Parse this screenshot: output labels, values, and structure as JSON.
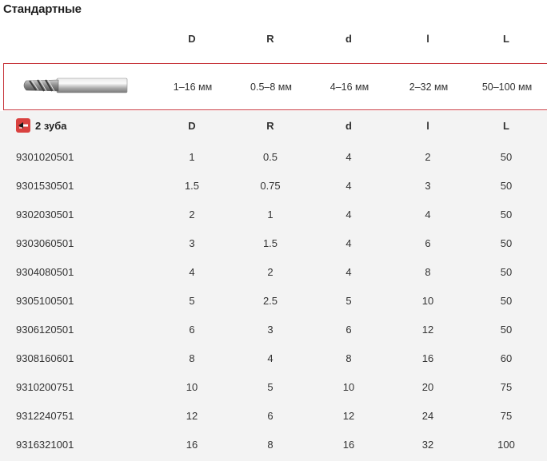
{
  "section": {
    "title": "Стандартные"
  },
  "columns": [
    "D",
    "R",
    "d",
    "l",
    "L"
  ],
  "ranges": [
    "1–16 мм",
    "0.5–8 мм",
    "4–16 мм",
    "2–32 мм",
    "50–100 мм"
  ],
  "group": {
    "label": "2 зуба",
    "icon": "two-flute-icon",
    "columns": [
      "D",
      "R",
      "d",
      "l",
      "L"
    ]
  },
  "rows": [
    {
      "code": "9301020501",
      "D": "1",
      "R": "0.5",
      "d": "4",
      "l": "2",
      "L": "50"
    },
    {
      "code": "9301530501",
      "D": "1.5",
      "R": "0.75",
      "d": "4",
      "l": "3",
      "L": "50"
    },
    {
      "code": "9302030501",
      "D": "2",
      "R": "1",
      "d": "4",
      "l": "4",
      "L": "50"
    },
    {
      "code": "9303060501",
      "D": "3",
      "R": "1.5",
      "d": "4",
      "l": "6",
      "L": "50"
    },
    {
      "code": "9304080501",
      "D": "4",
      "R": "2",
      "d": "4",
      "l": "8",
      "L": "50"
    },
    {
      "code": "9305100501",
      "D": "5",
      "R": "2.5",
      "d": "5",
      "l": "10",
      "L": "50"
    },
    {
      "code": "9306120501",
      "D": "6",
      "R": "3",
      "d": "6",
      "l": "12",
      "L": "50"
    },
    {
      "code": "9308160601",
      "D": "8",
      "R": "4",
      "d": "8",
      "l": "16",
      "L": "60"
    },
    {
      "code": "9310200751",
      "D": "10",
      "R": "5",
      "d": "10",
      "l": "20",
      "L": "75"
    },
    {
      "code": "9312240751",
      "D": "12",
      "R": "6",
      "d": "12",
      "l": "24",
      "L": "75"
    },
    {
      "code": "9316321001",
      "D": "16",
      "R": "8",
      "d": "16",
      "l": "32",
      "L": "100"
    }
  ],
  "colors": {
    "accent": "#c7353b",
    "table_bg": "#f3f3f3"
  }
}
